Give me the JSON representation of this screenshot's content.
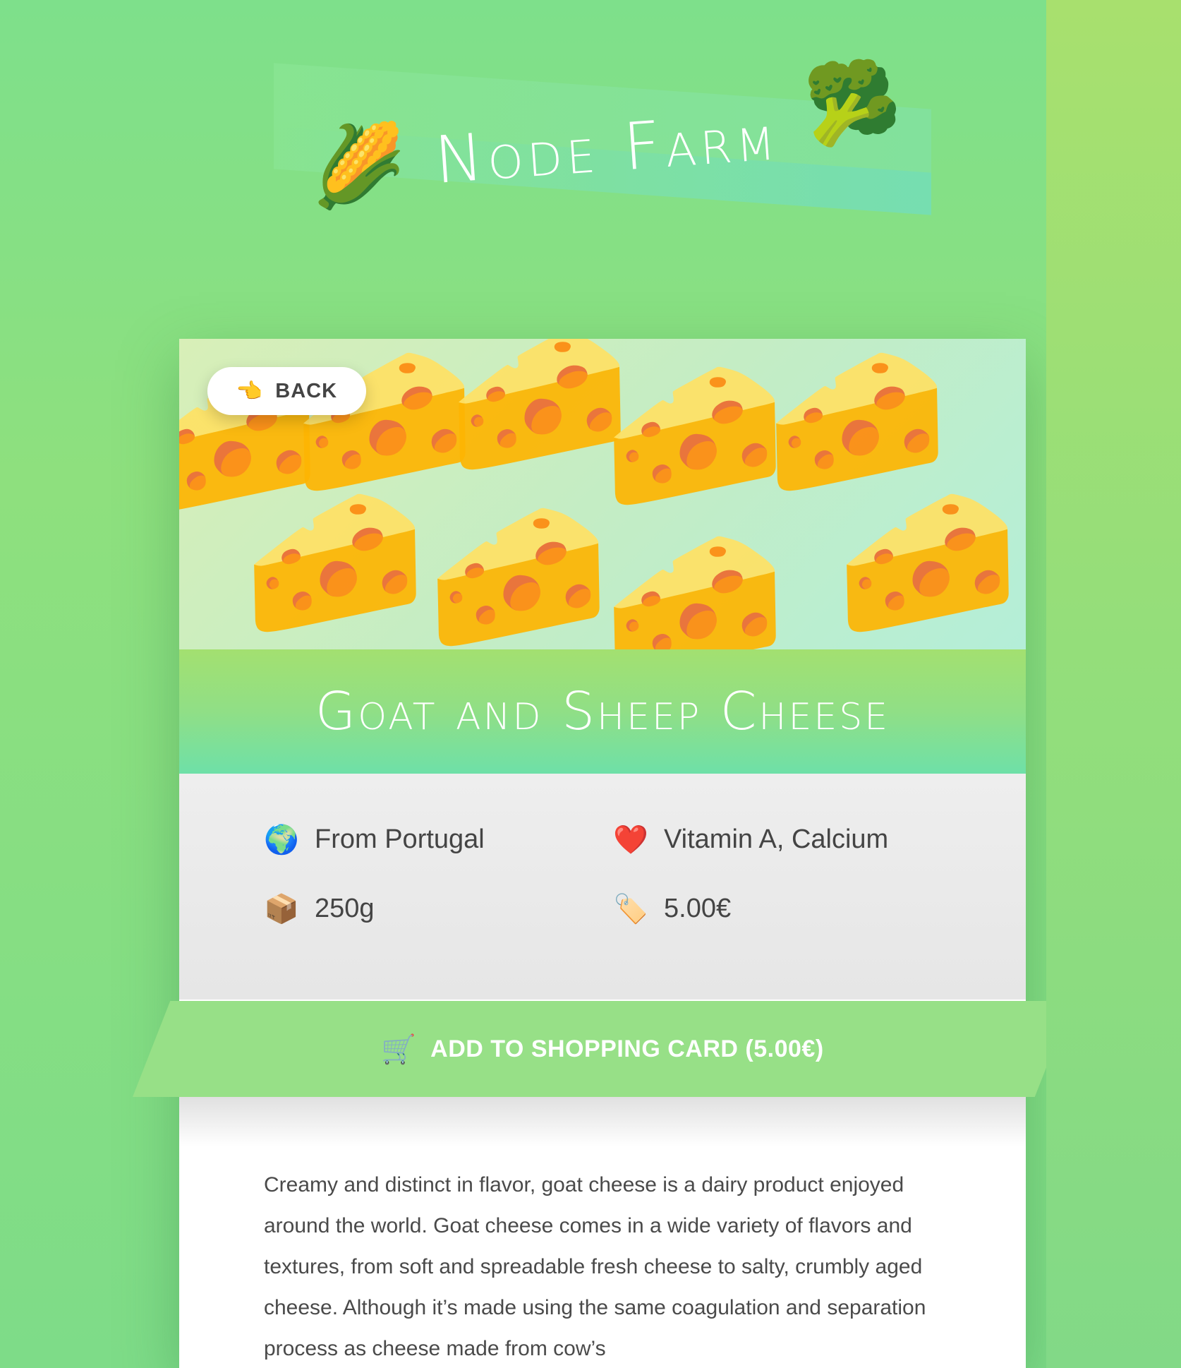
{
  "header": {
    "title": "Node Farm",
    "left_emoji": "🌽",
    "right_emoji": "🥦"
  },
  "product": {
    "image_emoji": "🧀",
    "back_button": {
      "icon": "👈",
      "label": "BACK"
    },
    "name": "Goat and Sheep Cheese",
    "details": {
      "origin": {
        "icon": "🌍",
        "text": "From Portugal"
      },
      "nutrients": {
        "icon": "❤️",
        "text": "Vitamin A, Calcium"
      },
      "quantity": {
        "icon": "📦",
        "text": "250g"
      },
      "price": {
        "icon": "🏷️",
        "text": "5.00€"
      }
    },
    "cart_button": {
      "icon": "🛒",
      "label": "ADD TO SHOPPING CARD (5.00€)"
    },
    "description": "Creamy and distinct in flavor, goat cheese is a dairy product enjoyed around the world. Goat cheese comes in a wide variety of flavors and textures, from soft and spreadable fresh cheese to salty, crumbly aged cheese. Although it’s made using the same coagulation and separation process as cheese made from cow’s"
  },
  "colors": {
    "background_green": "#8ee07e",
    "accent_green": "#97e087",
    "text_gray": "#444444"
  }
}
